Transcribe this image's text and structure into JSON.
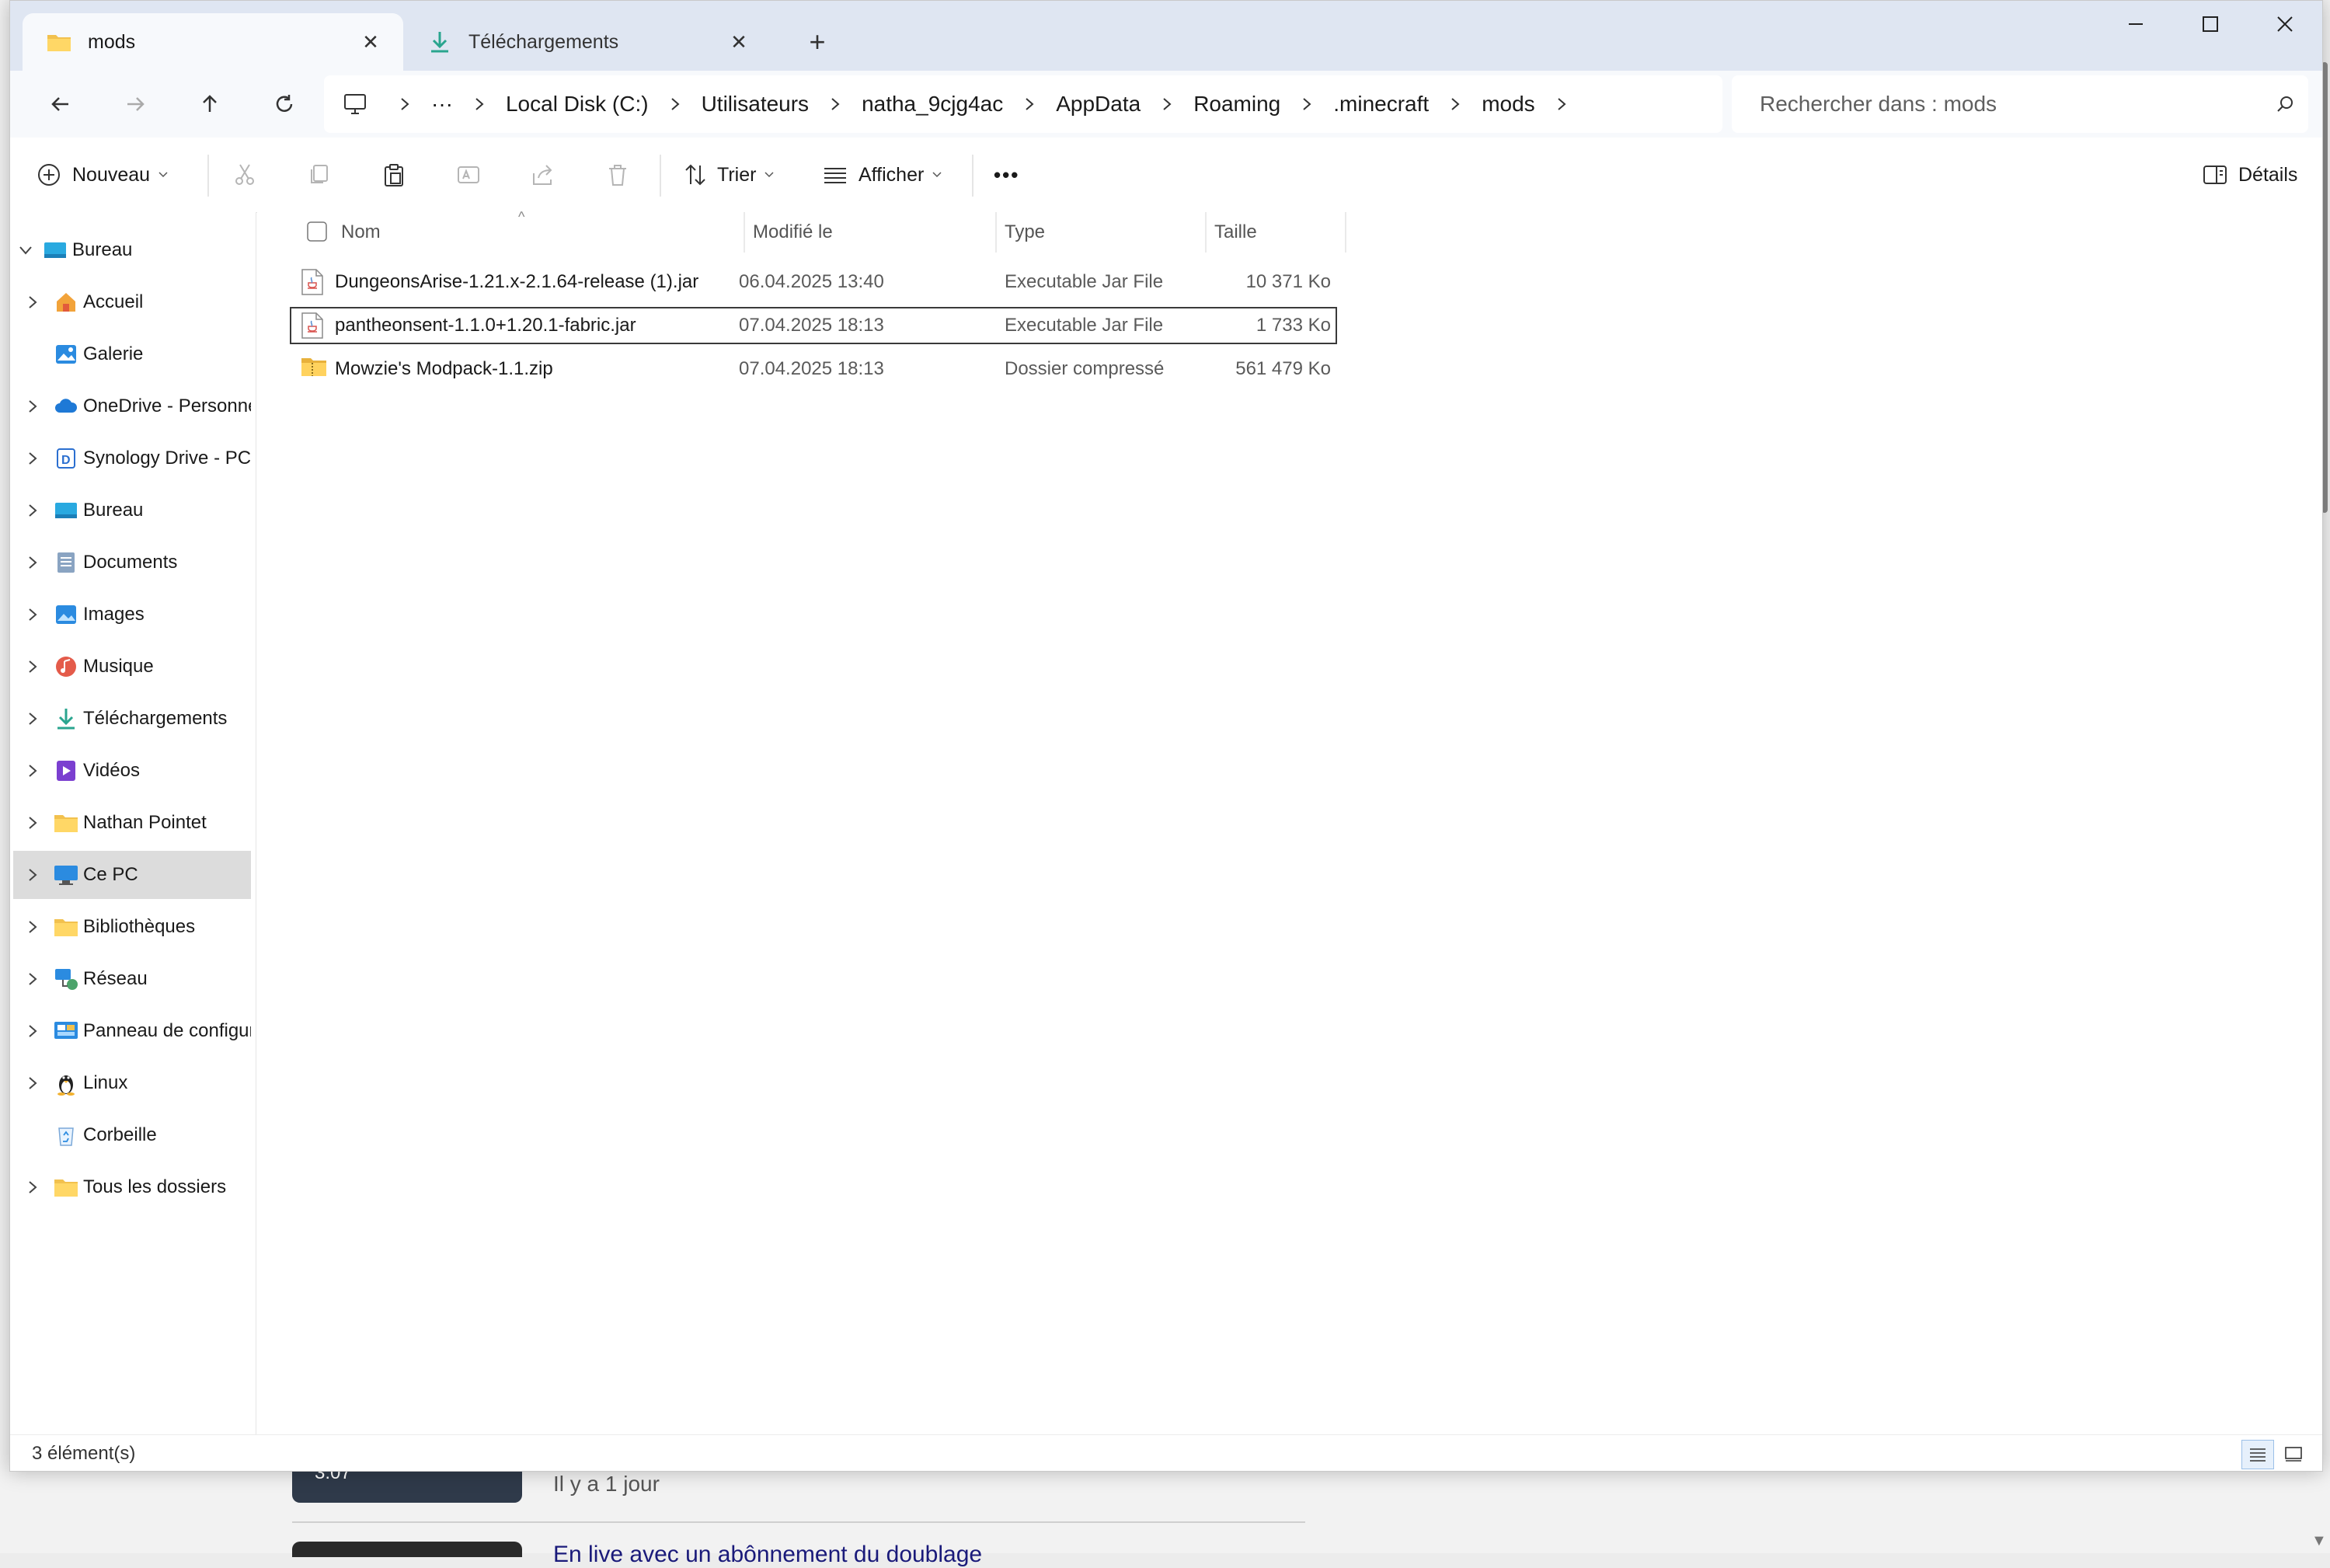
{
  "tabs": [
    {
      "label": "mods",
      "active": true
    },
    {
      "label": "Téléchargements",
      "active": false
    }
  ],
  "breadcrumb": {
    "overflow": "···",
    "items": [
      "Local Disk (C:)",
      "Utilisateurs",
      "natha_9cjg4ac",
      "AppData",
      "Roaming",
      ".minecraft",
      "mods"
    ]
  },
  "search": {
    "placeholder": "Rechercher dans : mods"
  },
  "toolbar": {
    "new_label": "Nouveau",
    "sort_label": "Trier",
    "view_label": "Afficher",
    "more_label": "•••",
    "details_label": "Détails"
  },
  "sidebar": {
    "items": [
      {
        "label": "Bureau",
        "icon": "desktop-icon"
      },
      {
        "label": "Accueil",
        "icon": "home-icon"
      },
      {
        "label": "Galerie",
        "icon": "gallery-icon"
      },
      {
        "label": "OneDrive - Personnel",
        "icon": "cloud-icon"
      },
      {
        "label": "Synology Drive - PC",
        "icon": "synology-icon"
      },
      {
        "label": "Bureau",
        "icon": "desktop-icon"
      },
      {
        "label": "Documents",
        "icon": "documents-icon"
      },
      {
        "label": "Images",
        "icon": "images-icon"
      },
      {
        "label": "Musique",
        "icon": "music-icon"
      },
      {
        "label": "Téléchargements",
        "icon": "download-icon"
      },
      {
        "label": "Vidéos",
        "icon": "videos-icon"
      },
      {
        "label": "Nathan Pointet",
        "icon": "folder-icon"
      },
      {
        "label": "Ce PC",
        "icon": "pc-icon"
      },
      {
        "label": "Bibliothèques",
        "icon": "folder-icon"
      },
      {
        "label": "Réseau",
        "icon": "network-icon"
      },
      {
        "label": "Panneau de configuration",
        "icon": "control-panel-icon"
      },
      {
        "label": "Linux",
        "icon": "linux-icon"
      },
      {
        "label": "Corbeille",
        "icon": "recycle-bin-icon"
      },
      {
        "label": "Tous les dossiers",
        "icon": "folder-icon"
      }
    ]
  },
  "columns": {
    "name": "Nom",
    "modified": "Modifié le",
    "type": "Type",
    "size": "Taille"
  },
  "files": [
    {
      "name": "DungeonsArise-1.21.x-2.1.64-release (1).jar",
      "modified": "06.04.2025 13:40",
      "type": "Executable Jar File",
      "size": "10 371 Ko",
      "icon": "jar-file-icon"
    },
    {
      "name": "pantheonsent-1.1.0+1.20.1-fabric.jar",
      "modified": "07.04.2025 18:13",
      "type": "Executable Jar File",
      "size": "1 733 Ko",
      "icon": "jar-file-icon"
    },
    {
      "name": "Mowzie's Modpack-1.1.zip",
      "modified": "07.04.2025 18:13",
      "type": "Dossier compressé",
      "size": "561 479 Ko",
      "icon": "zip-folder-icon"
    }
  ],
  "status": {
    "count_text": "3 élément(s)"
  },
  "background": {
    "duration": "3:07",
    "meta": "Il y a 1 jour",
    "title": "En live avec un abônnement du doublage"
  }
}
